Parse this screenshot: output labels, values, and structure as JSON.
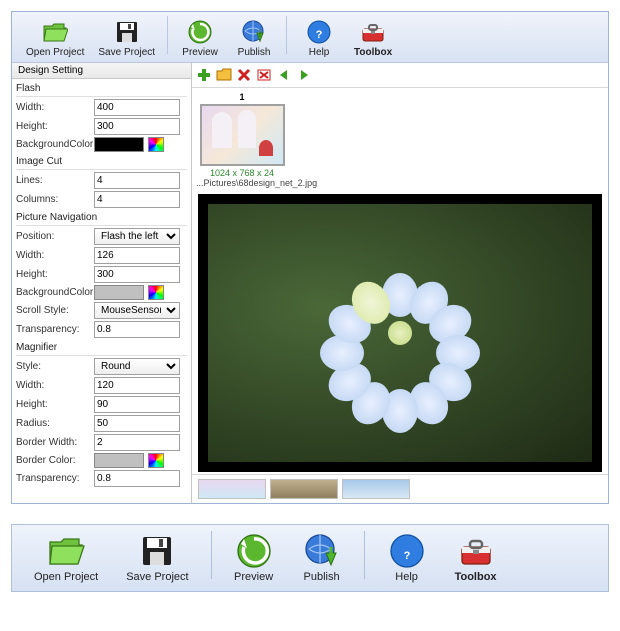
{
  "toolbar": {
    "open": "Open Project",
    "save": "Save Project",
    "preview": "Preview",
    "publish": "Publish",
    "help": "Help",
    "toolbox": "Toolbox"
  },
  "tab": "Design Setting",
  "flash": {
    "title": "Flash",
    "width_lbl": "Width:",
    "width": "400",
    "height_lbl": "Height:",
    "height": "300",
    "bgcolor_lbl": "BackgroundColor:",
    "bgcolor": "#000000"
  },
  "imagecut": {
    "title": "Image Cut",
    "lines_lbl": "Lines:",
    "lines": "4",
    "cols_lbl": "Columns:",
    "cols": "4"
  },
  "picnav": {
    "title": "Picture Navigation",
    "position_lbl": "Position:",
    "position": "Flash the left",
    "width_lbl": "Width:",
    "width": "126",
    "height_lbl": "Height:",
    "height": "300",
    "bgcolor_lbl": "BackgroundColor:",
    "bgcolor": "#c0c0c0",
    "scroll_lbl": "Scroll Style:",
    "scroll": "MouseSensor",
    "trans_lbl": "Transparency:",
    "trans": "0.8"
  },
  "mag": {
    "title": "Magnifier",
    "style_lbl": "Style:",
    "style": "Round",
    "width_lbl": "Width:",
    "width": "120",
    "height_lbl": "Height:",
    "height": "90",
    "radius_lbl": "Radius:",
    "radius": "50",
    "bw_lbl": "Border Width:",
    "bw": "2",
    "bc_lbl": "Border Color:",
    "bc": "#c0c0c0",
    "trans_lbl": "Transparency:",
    "trans": "0.8"
  },
  "thumb": {
    "num": "1",
    "meta": "1024 x 768 x 24",
    "path": "...Pictures\\68design_net_2.jpg"
  }
}
